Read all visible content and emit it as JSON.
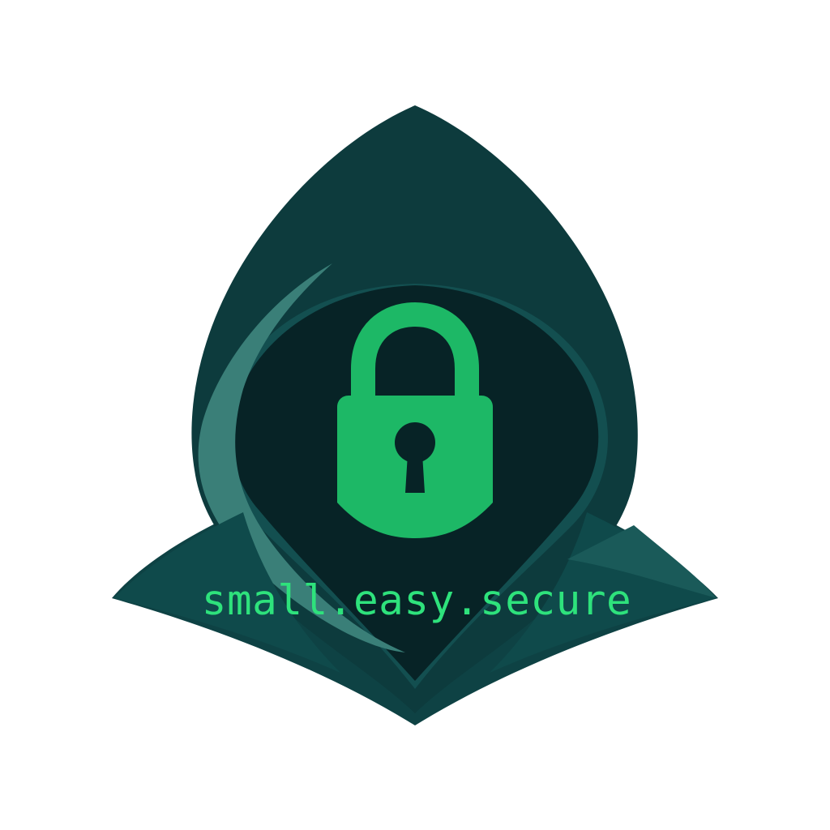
{
  "logo": {
    "tagline": "small.easy.secure",
    "icon": "hooded-figure-with-padlock-icon"
  },
  "colors": {
    "background": "#ffffff",
    "hood_dark": "#0d3a3c",
    "hood_mid": "#125052",
    "hood_highlight": "#3a7f78",
    "face_shadow": "#072326",
    "lock_green": "#1db866",
    "tagline_green": "#2ee27c"
  }
}
